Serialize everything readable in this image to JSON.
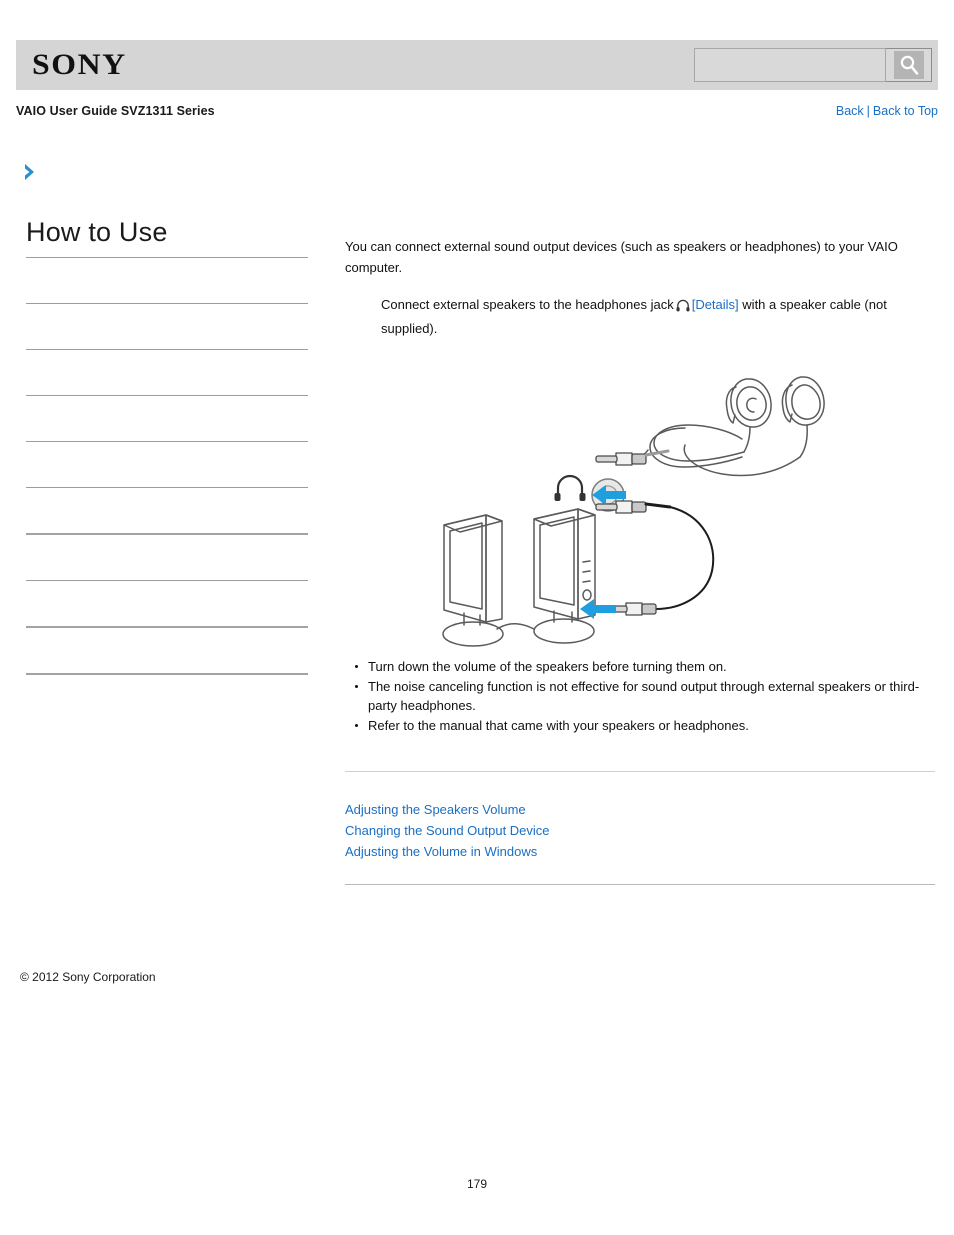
{
  "header": {
    "logo_text": "SONY",
    "search": {
      "value": "",
      "placeholder": "",
      "button_icon": "search-icon"
    }
  },
  "sub_header": {
    "guide_title": "VAIO User Guide SVZ1311 Series",
    "nav": {
      "back_label": "Back",
      "separator": "|",
      "back_to_top_label": "Back to Top"
    }
  },
  "breadcrumb": {
    "icon": "chevron-right-icon",
    "text": ""
  },
  "sidebar": {
    "title": "How to Use",
    "items": [
      {
        "label": ""
      },
      {
        "label": ""
      },
      {
        "label": ""
      },
      {
        "label": ""
      },
      {
        "label": ""
      },
      {
        "label": ""
      },
      {
        "label": ""
      },
      {
        "label": ""
      },
      {
        "label": ""
      },
      {
        "label": ""
      }
    ]
  },
  "main": {
    "intro_paragraph": "You can connect external sound output devices (such as speakers or headphones) to your VAIO computer.",
    "instruction": {
      "text_before_icon": "Connect external speakers to the headphones jack",
      "jack_icon": "headphones-icon",
      "details_link": "[Details]",
      "text_after_link": "with a speaker cable (not supplied)."
    },
    "figure": {
      "alt": "Illustration showing external speakers and headphones connected to the headphones jack",
      "arrow_color": "#1f9ee0",
      "labels": {
        "jack_symbol": "headphones-jack-symbol",
        "port": "headphones-port"
      }
    },
    "notes_group_1": [
      "Turn down the volume of the speakers before turning them on.",
      "The noise canceling function is not effective for sound output through external speakers or third-party headphones."
    ],
    "notes_group_2": [
      "Refer to the manual that came with your speakers or headphones."
    ],
    "related_links": [
      "Adjusting the Speakers Volume",
      "Changing the Sound Output Device",
      "Adjusting the Volume in Windows"
    ]
  },
  "footer": {
    "copyright": "© 2012 Sony Corporation",
    "page_number": "179"
  },
  "colors": {
    "link_blue": "#1a6fc4",
    "header_gray": "#d5d5d5",
    "arrow_blue": "#1f9ee0"
  }
}
